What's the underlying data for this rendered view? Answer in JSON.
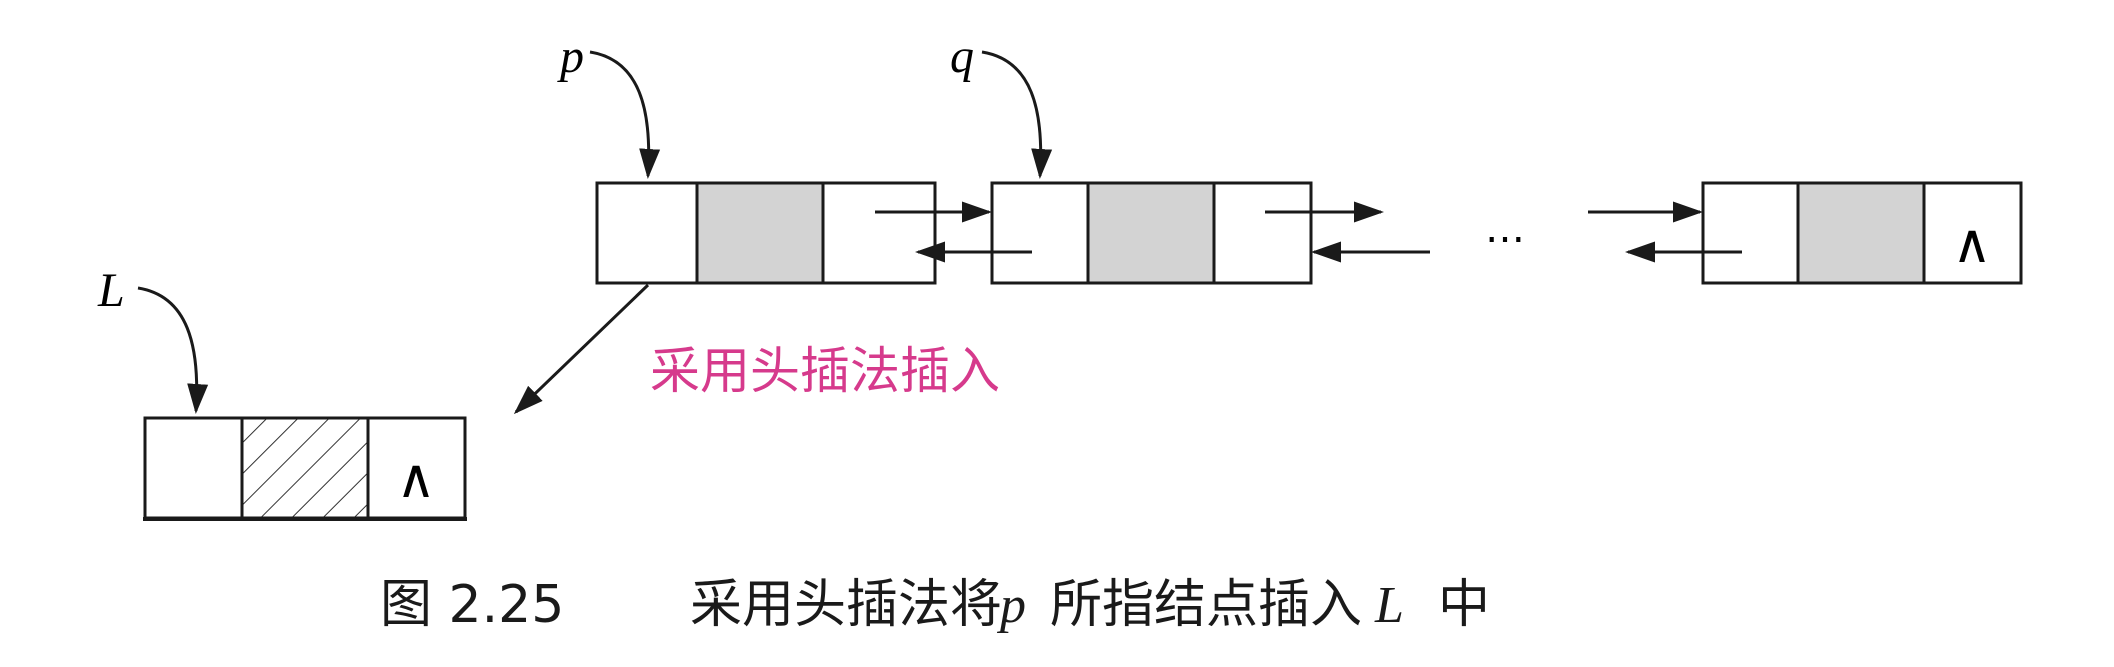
{
  "labels": {
    "pointer_p": "p",
    "pointer_q": "q",
    "pointer_L": "L",
    "ellipsis": "…",
    "null_symbol": "∧",
    "annotation": "采用头插法插入"
  },
  "caption": {
    "figure_number": "图 2.25",
    "text_before": "采用头插法将",
    "variable_p": "p",
    "text_middle": "所指结点插入",
    "variable_L": "L",
    "text_after": "中"
  },
  "colors": {
    "annotation": "#d63a8c",
    "data_fill": "#d3d3d3",
    "line": "#1a1a1a"
  }
}
